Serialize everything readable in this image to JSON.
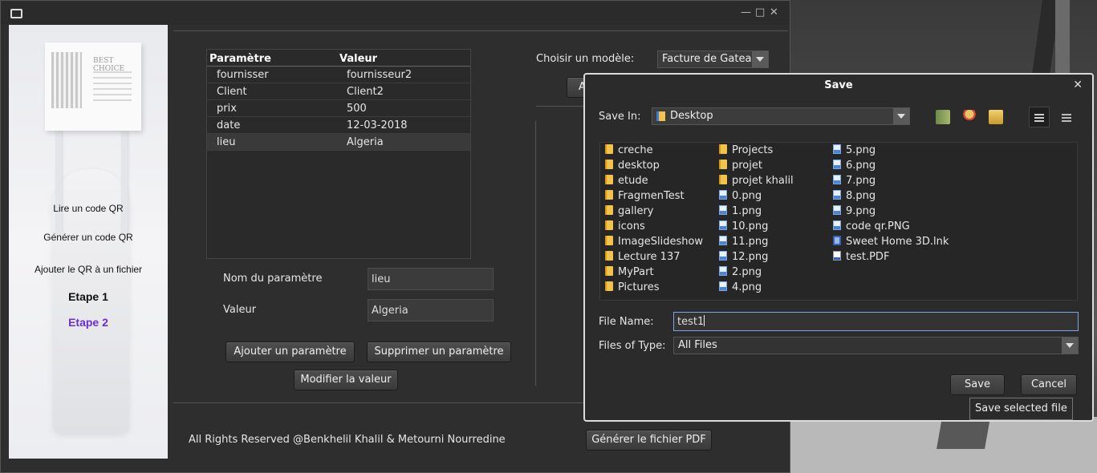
{
  "window": {
    "minimize": "—",
    "maximize": "□",
    "close": "✕"
  },
  "sidebar": {
    "card_caption": "BEST CHOICE",
    "items": [
      {
        "label": "Lire un code QR"
      },
      {
        "label": "Générer un code QR"
      },
      {
        "label": "Ajouter le QR à un fichier"
      },
      {
        "label": "Etape 1"
      },
      {
        "label": "Etape 2"
      }
    ],
    "active_color": "#6a2fd6"
  },
  "table": {
    "headers": [
      "Paramètre",
      "Valeur"
    ],
    "rows": [
      [
        "fournisser",
        "fournisseur2"
      ],
      [
        "Client",
        "Client2"
      ],
      [
        "prix",
        "500"
      ],
      [
        "date",
        "12-03-2018"
      ],
      [
        "lieu",
        "Algeria"
      ]
    ]
  },
  "form": {
    "param_label": "Nom du paramètre",
    "param_value": "lieu",
    "value_label": "Valeur",
    "value_value": "Algeria",
    "add_button": "Ajouter un paramètre",
    "delete_button": "Supprimer un paramètre",
    "modify_button": "Modifier la valeur"
  },
  "model": {
    "label": "Choisir un modèle:",
    "selected": "Facture de Gateau",
    "partial_button": "A"
  },
  "footer": {
    "copyright": "All Rights Reserved @Benkhelil Khalil & Metourni Nourredine",
    "generate_button": "Générer le fichier PDF"
  },
  "save_dialog": {
    "title": "Save",
    "close": "✕",
    "save_in_label": "Save In:",
    "save_in_value": "Desktop",
    "files": [
      {
        "name": "creche",
        "type": "folder"
      },
      {
        "name": "desktop",
        "type": "folder"
      },
      {
        "name": "etude",
        "type": "folder"
      },
      {
        "name": "FragmenTest",
        "type": "folder"
      },
      {
        "name": "gallery",
        "type": "folder"
      },
      {
        "name": "icons",
        "type": "folder"
      },
      {
        "name": "ImageSlideshow",
        "type": "folder"
      },
      {
        "name": "Lecture 137",
        "type": "folder"
      },
      {
        "name": "MyPart",
        "type": "folder"
      },
      {
        "name": "Pictures",
        "type": "folder"
      },
      {
        "name": "Projects",
        "type": "folder"
      },
      {
        "name": "projet",
        "type": "folder"
      },
      {
        "name": "projet khalil",
        "type": "folder"
      },
      {
        "name": "0.png",
        "type": "png"
      },
      {
        "name": "1.png",
        "type": "png"
      },
      {
        "name": "10.png",
        "type": "png"
      },
      {
        "name": "11.png",
        "type": "png"
      },
      {
        "name": "12.png",
        "type": "png"
      },
      {
        "name": "2.png",
        "type": "png"
      },
      {
        "name": "4.png",
        "type": "png"
      },
      {
        "name": "5.png",
        "type": "png"
      },
      {
        "name": "6.png",
        "type": "png"
      },
      {
        "name": "7.png",
        "type": "png"
      },
      {
        "name": "8.png",
        "type": "png"
      },
      {
        "name": "9.png",
        "type": "png"
      },
      {
        "name": "code qr.PNG",
        "type": "png"
      },
      {
        "name": "Sweet Home 3D.lnk",
        "type": "lnk"
      },
      {
        "name": "test.PDF",
        "type": "pdf"
      }
    ],
    "file_name_label": "File Name:",
    "file_name_value": "test1",
    "file_type_label": "Files of Type:",
    "file_type_value": "All Files",
    "save_button": "Save",
    "cancel_button": "Cancel",
    "tooltip": "Save selected file",
    "toolbar_icons": [
      "up-folder-icon",
      "home-icon",
      "new-folder-icon",
      "list-view-icon",
      "details-view-icon"
    ]
  }
}
